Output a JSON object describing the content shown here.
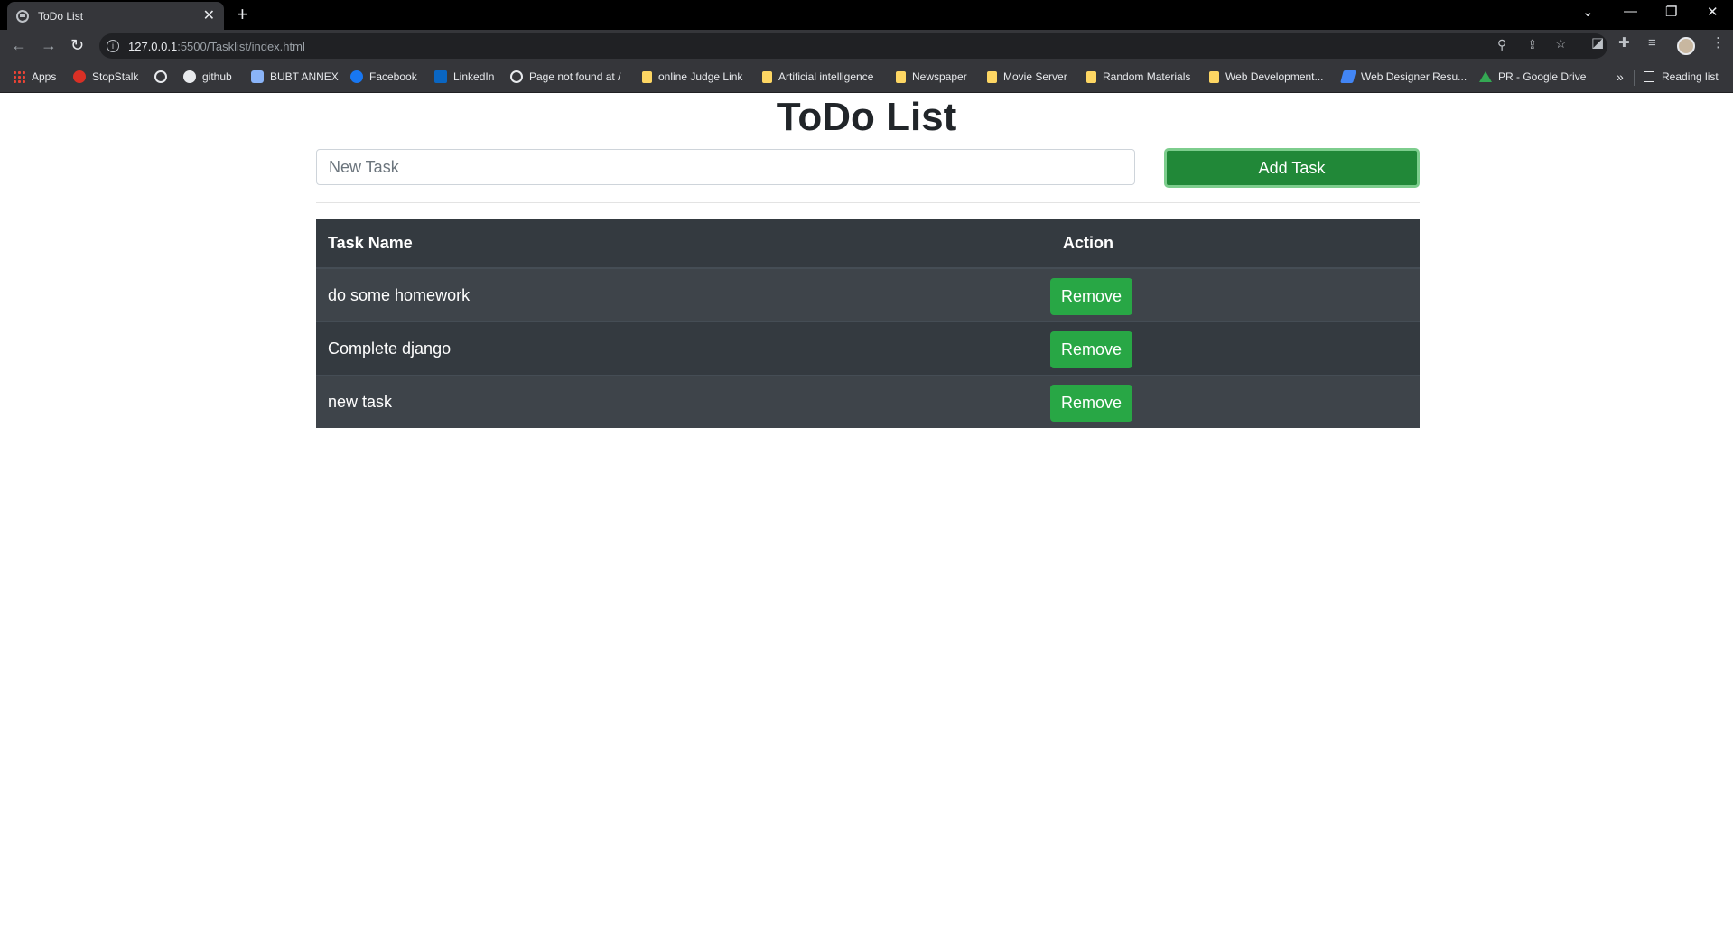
{
  "browser": {
    "tab_title": "ToDo List",
    "tab_close": "✕",
    "new_tab": "+",
    "url_host": "127.0.0.1",
    "url_path": ":5500/Tasklist/index.html",
    "window_controls": [
      "⌄",
      "—",
      "❐",
      "✕"
    ],
    "bookmarks": [
      {
        "label": "Apps",
        "icon": "apps-grid-icon"
      },
      {
        "label": "StopStalk",
        "icon": "stopstalk-icon"
      },
      {
        "label": "",
        "icon": "globe-icon"
      },
      {
        "label": "github",
        "icon": "github-icon"
      },
      {
        "label": "BUBT ANNEX",
        "icon": "bubt-icon"
      },
      {
        "label": "Facebook",
        "icon": "facebook-icon"
      },
      {
        "label": "LinkedIn",
        "icon": "linkedin-icon"
      },
      {
        "label": "Page not found at /",
        "icon": "globe-icon"
      },
      {
        "label": "online Judge Link",
        "icon": "folder-icon"
      },
      {
        "label": "Artificial intelligence",
        "icon": "folder-icon"
      },
      {
        "label": "Newspaper",
        "icon": "folder-icon"
      },
      {
        "label": "Movie Server",
        "icon": "folder-icon"
      },
      {
        "label": "Random Materials",
        "icon": "folder-icon"
      },
      {
        "label": "Web Development...",
        "icon": "folder-icon"
      },
      {
        "label": "Web Designer Resu...",
        "icon": "web-designer-icon"
      },
      {
        "label": "PR - Google Drive",
        "icon": "google-drive-icon"
      }
    ],
    "bookmarks_more": "»",
    "reading_list": "Reading list"
  },
  "page": {
    "heading": "ToDo List",
    "input_placeholder": "New Task",
    "input_value": "",
    "add_button": "Add Task",
    "table": {
      "headers": {
        "name": "Task Name",
        "action": "Action"
      },
      "rows": [
        {
          "name": "do some homework",
          "action": "Remove"
        },
        {
          "name": "Complete django",
          "action": "Remove"
        },
        {
          "name": "new task",
          "action": "Remove"
        }
      ]
    }
  },
  "colors": {
    "add_button": "#218838",
    "remove_button": "#28a745",
    "table_dark": "#343a40",
    "table_stripe": "#3e444a"
  }
}
